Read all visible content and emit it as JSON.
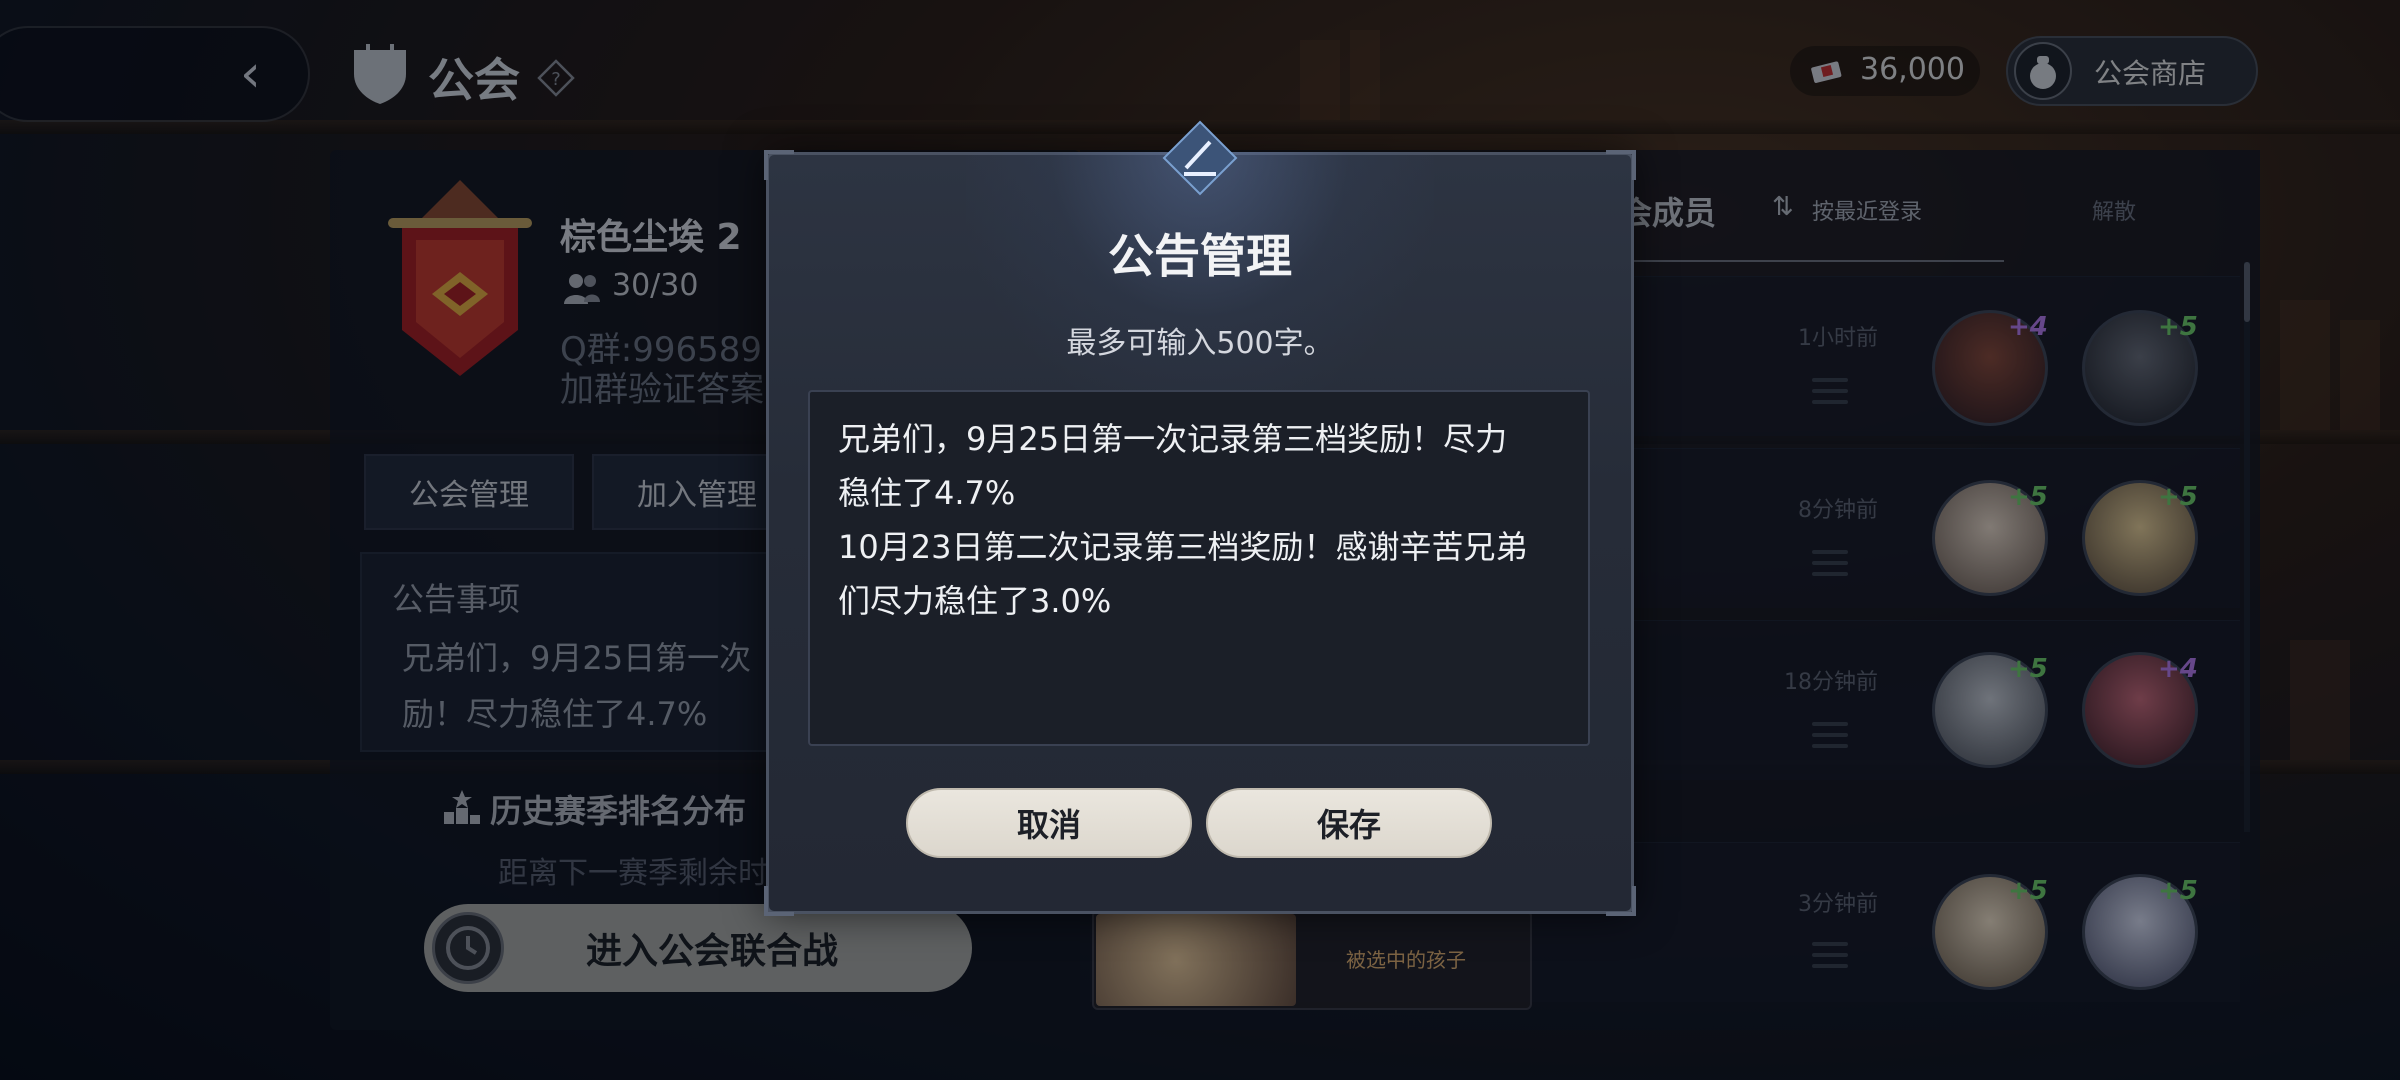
{
  "header": {
    "title": "公会",
    "currency_value": "36,000",
    "shop_label": "公会商店"
  },
  "guild": {
    "name": "棕色尘埃 2",
    "members": "30/30",
    "qq_group": "Q群:996589",
    "verify": "加群验证答案",
    "tabs": [
      "公会管理",
      "加入管理"
    ],
    "notice_title": "公告事项",
    "notice_preview": "兄弟们，9月25日第一次励！尽力稳住了4.7%",
    "history_label": "历史赛季排名分布",
    "countdown": "距离下一赛季剩余时",
    "enter_button": "进入公会联合战"
  },
  "members_panel": {
    "title": "会成员",
    "sort_label": "按最近登录",
    "dissolve_label": "解散",
    "selected_label": "被选中的孩子",
    "rows": [
      {
        "time": "1小时前",
        "badges": [
          "+4",
          "+5"
        ]
      },
      {
        "time": "8分钟前",
        "badges": [
          "+5",
          "+5"
        ]
      },
      {
        "time": "18分钟前",
        "badges": [
          "+5",
          "+4"
        ]
      },
      {
        "time": "3分钟前",
        "badges": [
          "+5",
          "+5"
        ]
      }
    ]
  },
  "modal": {
    "title": "公告管理",
    "subtitle": "最多可输入500字。",
    "text": "兄弟们，9月25日第一次记录第三档奖励！尽力\n稳住了4.7%\n10月23日第二次记录第三档奖励！感谢辛苦兄弟\n们尽力稳住了3.0%",
    "cancel_label": "取消",
    "save_label": "保存"
  },
  "colors": {
    "accent_badge_green": "#6fd06a",
    "accent_badge_purple": "#b87cf0",
    "button_bg": "#e4e0d8"
  }
}
